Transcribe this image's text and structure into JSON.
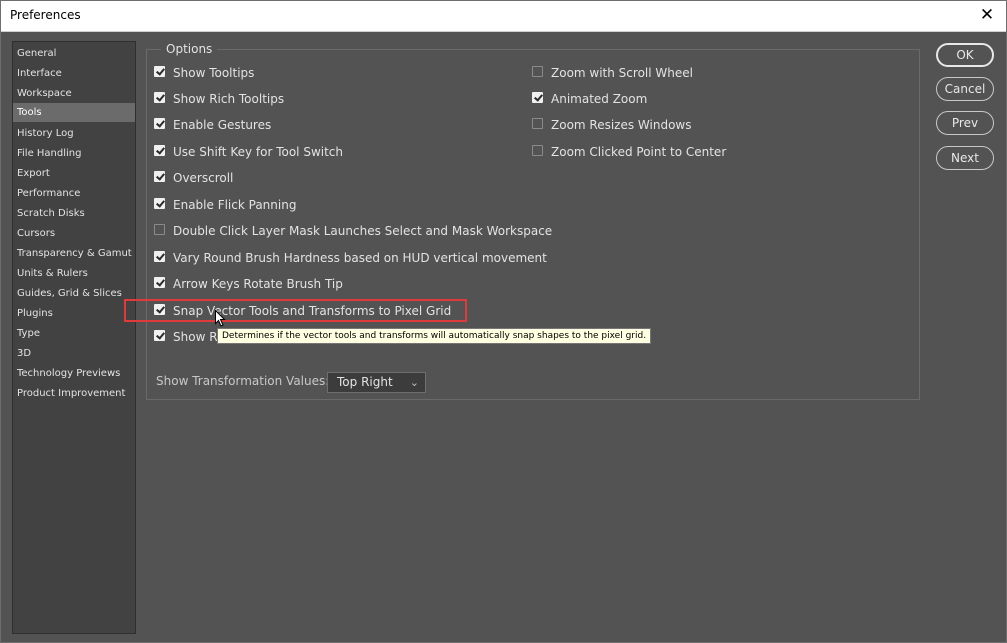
{
  "window": {
    "title": "Preferences",
    "close_glyph": "✕"
  },
  "sidebar": {
    "items": [
      {
        "label": "General"
      },
      {
        "label": "Interface"
      },
      {
        "label": "Workspace"
      },
      {
        "label": "Tools",
        "selected": true
      },
      {
        "label": "History Log"
      },
      {
        "label": "File Handling"
      },
      {
        "label": "Export"
      },
      {
        "label": "Performance"
      },
      {
        "label": "Scratch Disks"
      },
      {
        "label": "Cursors"
      },
      {
        "label": "Transparency & Gamut"
      },
      {
        "label": "Units & Rulers"
      },
      {
        "label": "Guides, Grid & Slices"
      },
      {
        "label": "Plugins"
      },
      {
        "label": "Type"
      },
      {
        "label": "3D"
      },
      {
        "label": "Technology Previews"
      },
      {
        "label": "Product Improvement"
      }
    ]
  },
  "options": {
    "title": "Options",
    "left": [
      {
        "label": "Show Tooltips",
        "checked": true
      },
      {
        "label": "Show Rich Tooltips",
        "checked": true
      },
      {
        "label": "Enable Gestures",
        "checked": true
      },
      {
        "label": "Use Shift Key for Tool Switch",
        "checked": true
      },
      {
        "label": "Overscroll",
        "checked": true
      },
      {
        "label": "Enable Flick Panning",
        "checked": true
      },
      {
        "label": "Double Click Layer Mask Launches Select and Mask Workspace",
        "checked": false
      },
      {
        "label": "Vary Round Brush Hardness based on HUD vertical movement",
        "checked": true
      },
      {
        "label": "Arrow Keys Rotate Brush Tip",
        "checked": true
      },
      {
        "label": "Snap Vector Tools and Transforms to Pixel Grid",
        "checked": true
      },
      {
        "label": "Show R",
        "checked": true
      }
    ],
    "right": [
      {
        "label": "Zoom with Scroll Wheel",
        "checked": false
      },
      {
        "label": "Animated Zoom",
        "checked": true
      },
      {
        "label": "Zoom Resizes Windows",
        "checked": false
      },
      {
        "label": "Zoom Clicked Point to Center",
        "checked": false
      }
    ],
    "tooltip": "Determines if the vector tools and transforms will automatically snap shapes to the pixel grid.",
    "transformation": {
      "label": "Show Transformation Values:",
      "selected": "Top Right",
      "chevron": "⌄"
    }
  },
  "buttons": {
    "ok": "OK",
    "cancel": "Cancel",
    "prev": "Prev",
    "next": "Next"
  }
}
